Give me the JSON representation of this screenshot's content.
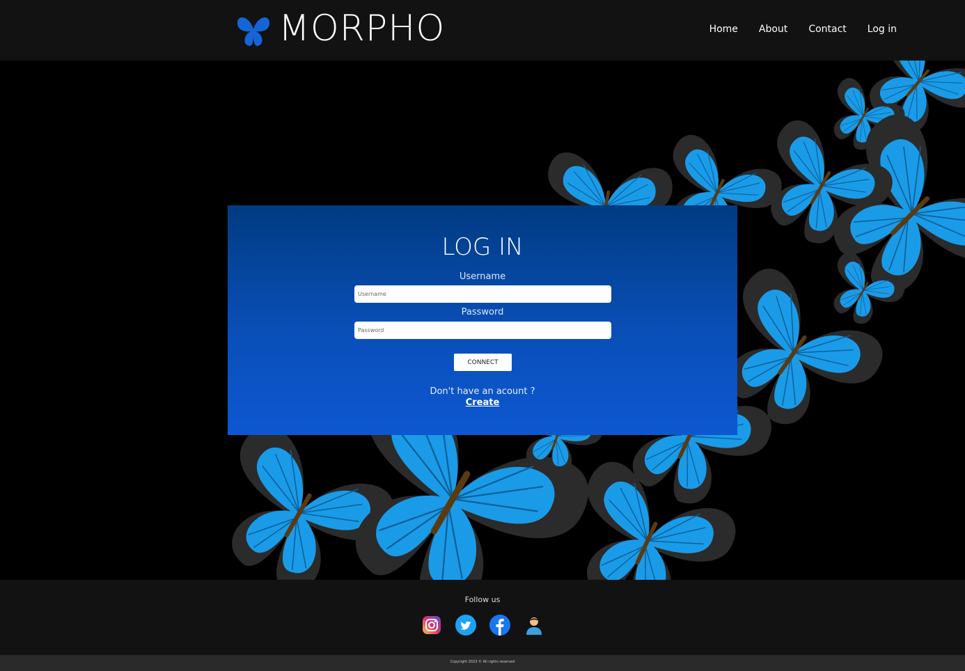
{
  "header": {
    "brand": "MORPHO",
    "nav": [
      {
        "label": "Home"
      },
      {
        "label": "About"
      },
      {
        "label": "Contact"
      },
      {
        "label": "Log in"
      }
    ]
  },
  "login": {
    "title": "LOG IN",
    "username_label": "Username",
    "username_placeholder": "Username",
    "password_label": "Password",
    "password_placeholder": "Password",
    "connect_label": "CONNECT",
    "no_account_text": "Don't have an acount ?",
    "create_label": "Create"
  },
  "footer": {
    "follow_text": "Follow us",
    "socials": [
      "instagram-icon",
      "twitter-icon",
      "facebook-icon",
      "user-icon"
    ],
    "copyright": "Copyright 2023 © All rights reserved"
  },
  "colors": {
    "header_bg": "#121212",
    "card_top": "#003b82",
    "card_bottom": "#0d57d1",
    "butterfly_blue": "#1a9be8",
    "logo_blue": "#1565d8"
  }
}
